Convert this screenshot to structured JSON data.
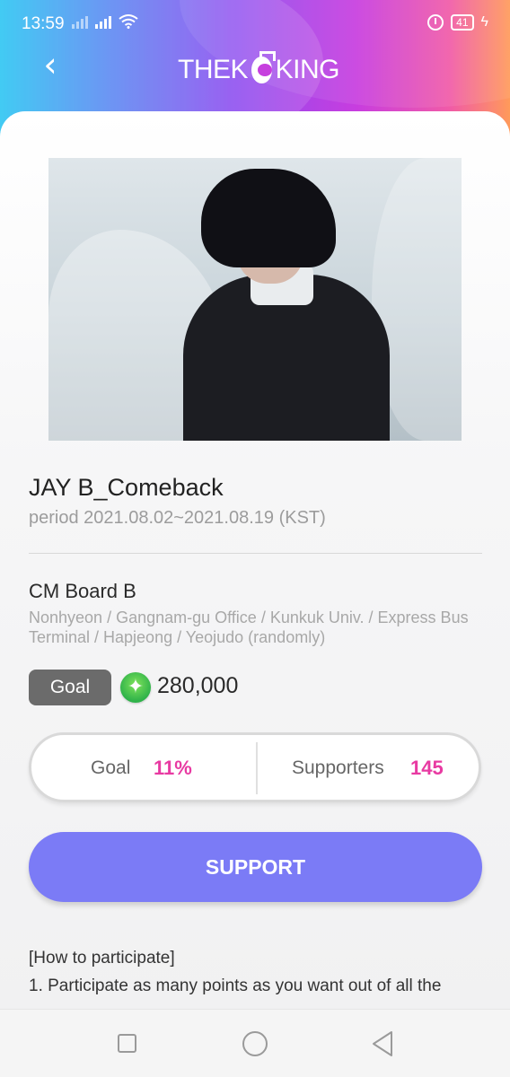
{
  "status_bar": {
    "time": "13:59",
    "battery": "41"
  },
  "header": {
    "logo_left": "THEK",
    "logo_right": "KING"
  },
  "event": {
    "title": "JAY B_Comeback",
    "period": "period 2021.08.02~2021.08.19 (KST)"
  },
  "board": {
    "name": "CM Board B",
    "locations": "Nonhyeon / Gangnam-gu Office / Kunkuk Univ. / Express Bus Terminal / Hapjeong / Yeojudo (randomly)"
  },
  "goal": {
    "badge": "Goal",
    "amount": "280,000"
  },
  "stats": {
    "goal_label": "Goal",
    "goal_value": "11%",
    "supporters_label": "Supporters",
    "supporters_value": "145"
  },
  "support_button": "SUPPORT",
  "how_to": {
    "title": "[How to participate]",
    "step1": "1. Participate as many points as you want out of all the"
  },
  "colors": {
    "accent_pink": "#e83aa2",
    "button_purple": "#7b7bf6"
  }
}
